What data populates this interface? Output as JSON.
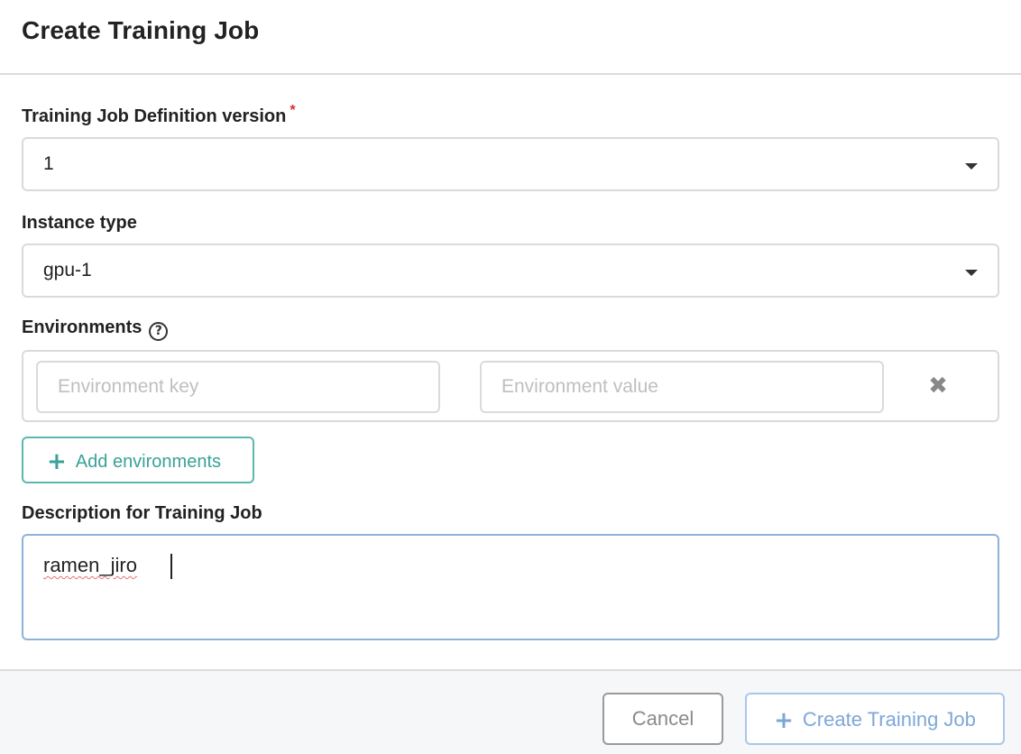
{
  "header": {
    "title": "Create Training Job"
  },
  "form": {
    "definition_version": {
      "label": "Training Job Definition version",
      "required_mark": "*",
      "value": "1"
    },
    "instance_type": {
      "label": "Instance type",
      "value": "gpu-1"
    },
    "environments": {
      "label": "Environments",
      "help_glyph": "?",
      "key_placeholder": "Environment key",
      "value_placeholder": "Environment value",
      "remove_glyph": "✖",
      "add_label": "Add environments",
      "add_glyph": "+"
    },
    "description": {
      "label": "Description for Training Job",
      "value": "ramen_jiro"
    }
  },
  "footer": {
    "cancel_label": "Cancel",
    "create_label": "Create Training Job",
    "create_glyph": "+"
  },
  "colors": {
    "accent_teal": "#3aa296",
    "primary_blue_disabled": "#7ea7d9",
    "required": "#d0342c"
  }
}
